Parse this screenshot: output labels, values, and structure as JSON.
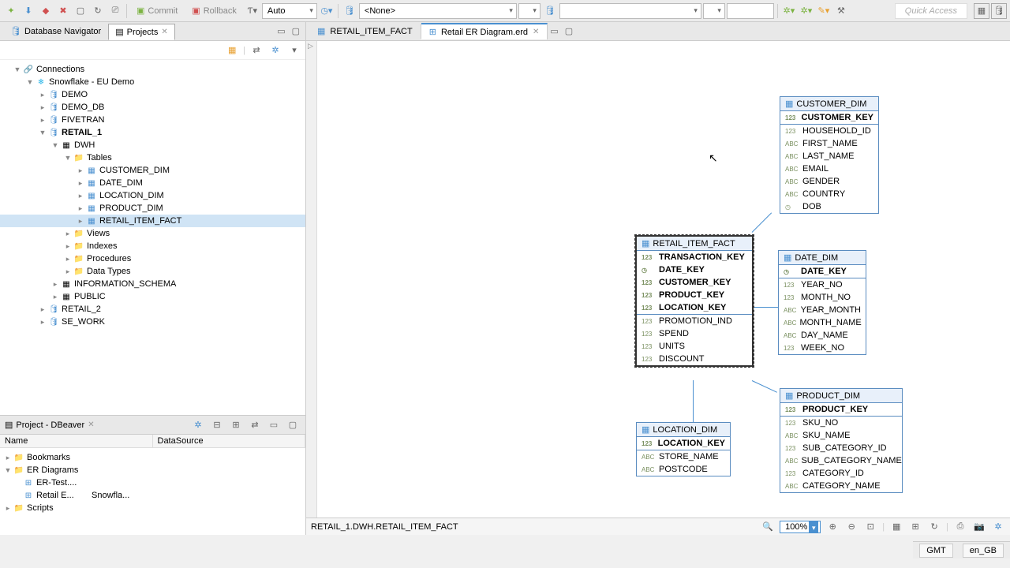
{
  "toolbar": {
    "commit": "Commit",
    "rollback": "Rollback",
    "mode": "Auto",
    "source_sel": "<None>",
    "quick_access": "Quick Access"
  },
  "left": {
    "nav_tab": "Database Navigator",
    "projects_tab": "Projects",
    "tree": {
      "root": "Connections",
      "conn": "Snowflake - EU Demo",
      "dbs": [
        "DEMO",
        "DEMO_DB",
        "FIVETRAN",
        "RETAIL_1"
      ],
      "schema": "DWH",
      "tables_label": "Tables",
      "tables": [
        "CUSTOMER_DIM",
        "DATE_DIM",
        "LOCATION_DIM",
        "PRODUCT_DIM",
        "RETAIL_ITEM_FACT"
      ],
      "folders": [
        "Views",
        "Indexes",
        "Procedures",
        "Data Types"
      ],
      "schemas2": [
        "INFORMATION_SCHEMA",
        "PUBLIC"
      ],
      "dbs2": [
        "RETAIL_2",
        "SE_WORK"
      ]
    },
    "project": {
      "title": "Project - DBeaver",
      "col_name": "Name",
      "col_ds": "DataSource",
      "bookmarks": "Bookmarks",
      "er": "ER Diagrams",
      "er_test": "ER-Test....",
      "retail_e": "Retail E...",
      "retail_e_ds": "Snowfla...",
      "scripts": "Scripts"
    }
  },
  "editor": {
    "tab1": "RETAIL_ITEM_FACT",
    "tab2": "Retail ER Diagram.erd",
    "footer_path": "RETAIL_1.DWH.RETAIL_ITEM_FACT",
    "zoom": "100%"
  },
  "er": {
    "customer": {
      "title": "CUSTOMER_DIM",
      "pk": "CUSTOMER_KEY",
      "cols": [
        "HOUSEHOLD_ID",
        "FIRST_NAME",
        "LAST_NAME",
        "EMAIL",
        "GENDER",
        "COUNTRY",
        "DOB"
      ],
      "types": [
        "123",
        "ABC",
        "ABC",
        "ABC",
        "ABC",
        "ABC",
        "◷"
      ]
    },
    "date": {
      "title": "DATE_DIM",
      "pk": "DATE_KEY",
      "cols": [
        "YEAR_NO",
        "MONTH_NO",
        "YEAR_MONTH",
        "MONTH_NAME",
        "DAY_NAME",
        "WEEK_NO"
      ],
      "types": [
        "123",
        "123",
        "ABC",
        "ABC",
        "ABC",
        "123"
      ]
    },
    "product": {
      "title": "PRODUCT_DIM",
      "pk": "PRODUCT_KEY",
      "cols": [
        "SKU_NO",
        "SKU_NAME",
        "SUB_CATEGORY_ID",
        "SUB_CATEGORY_NAME",
        "CATEGORY_ID",
        "CATEGORY_NAME"
      ],
      "types": [
        "123",
        "ABC",
        "123",
        "ABC",
        "123",
        "ABC"
      ]
    },
    "location": {
      "title": "LOCATION_DIM",
      "pk": "LOCATION_KEY",
      "cols": [
        "STORE_NAME",
        "POSTCODE"
      ],
      "types": [
        "ABC",
        "ABC"
      ]
    },
    "fact": {
      "title": "RETAIL_ITEM_FACT",
      "pks": [
        "TRANSACTION_KEY",
        "DATE_KEY",
        "CUSTOMER_KEY",
        "PRODUCT_KEY",
        "LOCATION_KEY"
      ],
      "pkt": [
        "123",
        "◷",
        "123",
        "123",
        "123"
      ],
      "cols": [
        "PROMOTION_IND",
        "SPEND",
        "UNITS",
        "DISCOUNT"
      ],
      "types": [
        "123",
        "123",
        "123",
        "123"
      ]
    }
  },
  "status": {
    "tz": "GMT",
    "locale": "en_GB"
  }
}
